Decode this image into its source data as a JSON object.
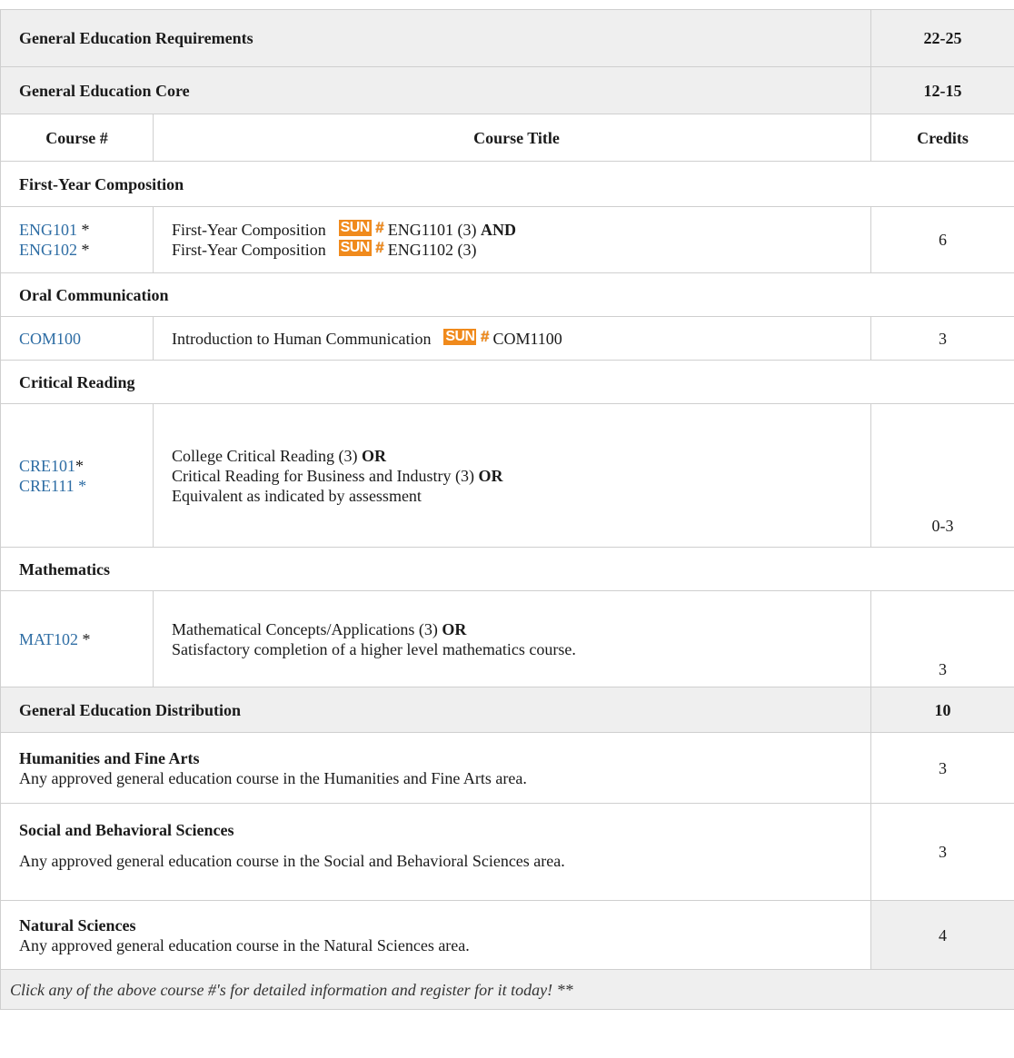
{
  "summary": {
    "title": "General Education Requirements",
    "credits": "22-25"
  },
  "core": {
    "title": "General Education Core",
    "credits": "12-15"
  },
  "columns": {
    "course_num": "Course #",
    "course_title": "Course Title",
    "credits": "Credits"
  },
  "composition": {
    "heading": "First-Year Composition",
    "course1_code": "ENG101",
    "course1_star": " *",
    "course2_code": "ENG102",
    "course2_star": " *",
    "title1": "First-Year Composition",
    "sun1": "ENG1101 (3) ",
    "and_word": "AND",
    "title2": "First-Year Composition",
    "sun2": "ENG1102 (3)",
    "credits": "6"
  },
  "oral": {
    "heading": "Oral Communication",
    "course_code": "COM100",
    "title": "Introduction to Human Communication",
    "sun": "COM1100",
    "credits": "3"
  },
  "critical": {
    "heading": "Critical Reading",
    "course1_code": "CRE101",
    "course1_star": "*",
    "course2_code": "CRE111",
    "course2_star": " *",
    "line1": "College Critical Reading (3) ",
    "line1_bold": "OR",
    "line2": "Critical Reading for Business and Industry (3) ",
    "line2_bold": "OR",
    "line3": "Equivalent as indicated by assessment",
    "credits": "0-3"
  },
  "math": {
    "heading": "Mathematics",
    "course_code": "MAT102",
    "course_star": " *",
    "line1": "Mathematical Concepts/Applications (3) ",
    "line1_bold": "OR",
    "line2": "Satisfactory completion of a higher level mathematics course.",
    "credits": "3"
  },
  "distribution": {
    "title": "General Education Distribution",
    "credits": "10"
  },
  "humanities": {
    "heading": "Humanities and Fine Arts",
    "text": "Any approved general education course in the Humanities and Fine Arts area.",
    "credits": "3"
  },
  "social": {
    "heading": "Social and Behavioral Sciences",
    "text": "Any approved general education course in the Social and Behavioral Sciences area.",
    "credits": "3"
  },
  "natural": {
    "heading": "Natural Sciences",
    "text": "Any approved general education course in the Natural Sciences area.",
    "credits": "4"
  },
  "sun_badge": {
    "label": "SUN",
    "hash": "#",
    "color": "#f08a1c"
  },
  "footer": {
    "note": "Click any of the above course #'s for detailed information and register for it today! **"
  },
  "colors": {
    "link": "#2e6da4",
    "shade": "#efefef",
    "border": "#cfcfcf"
  }
}
